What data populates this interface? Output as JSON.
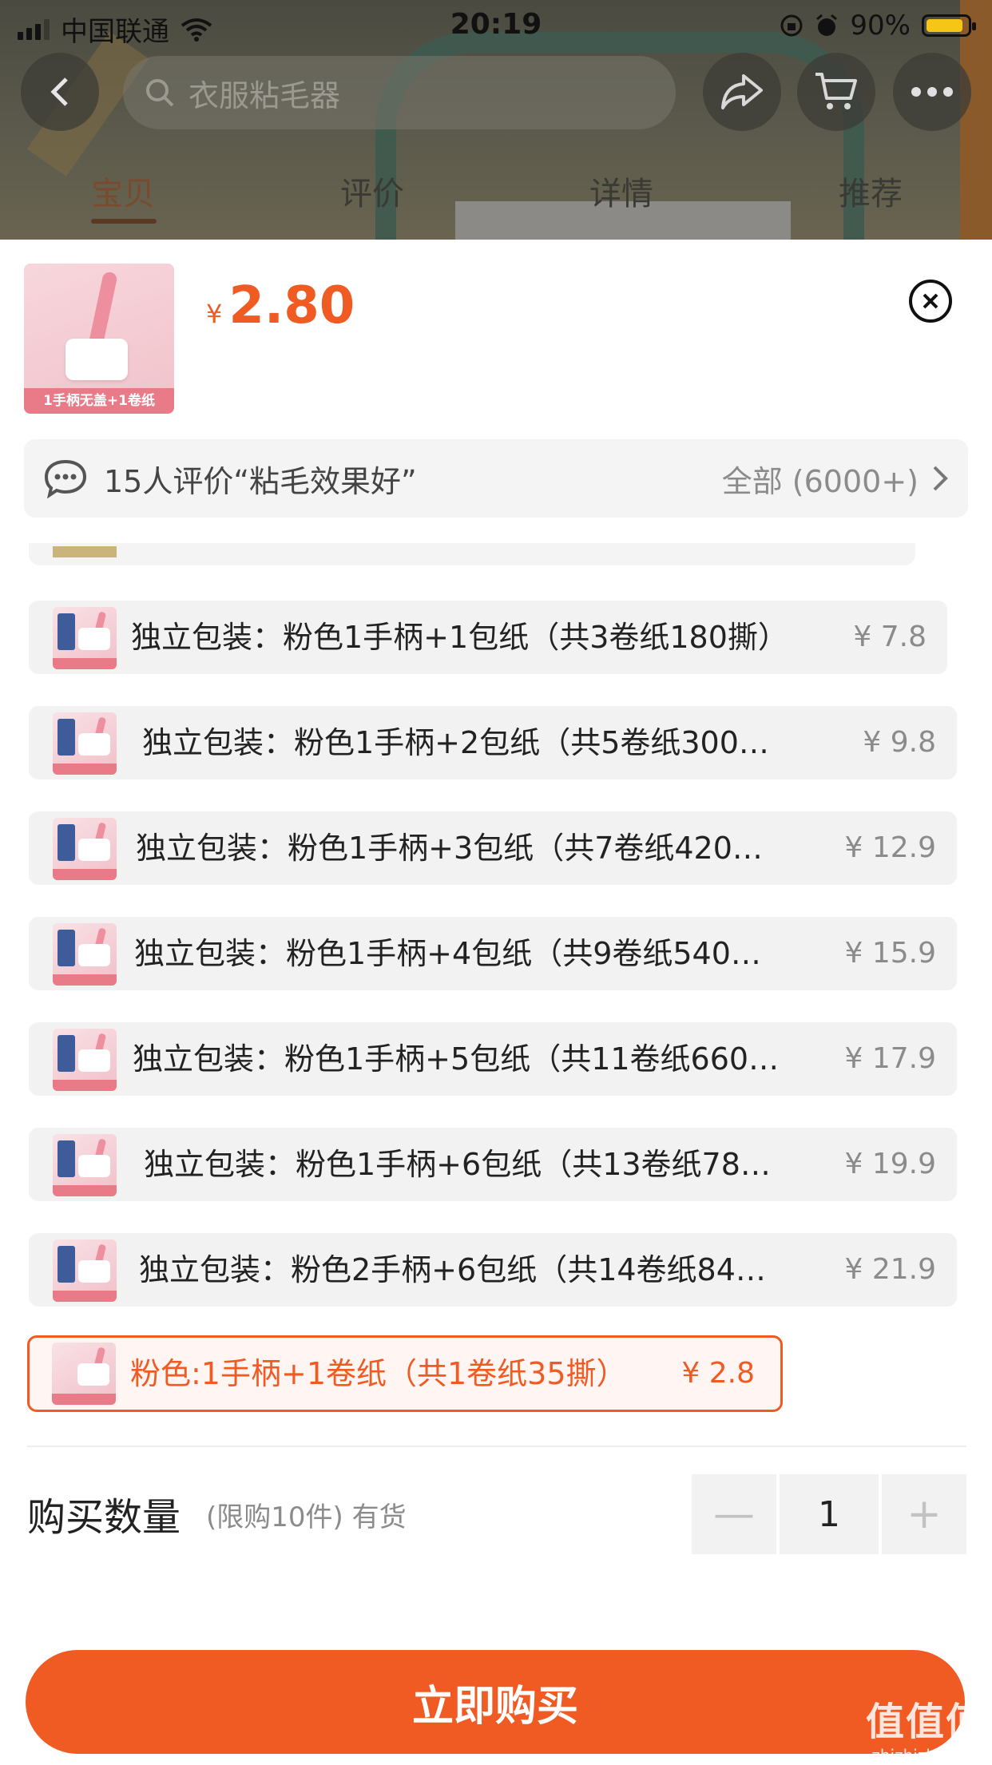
{
  "status_bar": {
    "carrier": "中国联通",
    "time": "20:19",
    "battery": "90%",
    "battery_level": 0.9
  },
  "top_nav": {
    "search_placeholder": "衣服粘毛器",
    "tabs": [
      {
        "label": "宝贝",
        "active": true
      },
      {
        "label": "评价",
        "active": false
      },
      {
        "label": "详情",
        "active": false
      },
      {
        "label": "推荐",
        "active": false
      }
    ]
  },
  "product": {
    "currency": "¥",
    "price": "2.80",
    "thumbnail_caption": "1手柄无盖+1卷纸"
  },
  "review_bar": {
    "text": "15人评价“粘毛效果好”",
    "all_label": "全部 (6000+)"
  },
  "options": [
    {
      "label": "独立包装：粉色1手柄+1包纸（共3卷纸180撕）",
      "price": "¥ 7.8",
      "selected": false
    },
    {
      "label": "独立包装：粉色1手柄+2包纸（共5卷纸300…",
      "price": "¥ 9.8",
      "selected": false
    },
    {
      "label": "独立包装：粉色1手柄+3包纸（共7卷纸420…",
      "price": "¥ 12.9",
      "selected": false
    },
    {
      "label": "独立包装：粉色1手柄+4包纸（共9卷纸540…",
      "price": "¥ 15.9",
      "selected": false
    },
    {
      "label": "独立包装：粉色1手柄+5包纸（共11卷纸660…",
      "price": "¥ 17.9",
      "selected": false
    },
    {
      "label": "独立包装：粉色1手柄+6包纸（共13卷纸78…",
      "price": "¥ 19.9",
      "selected": false
    },
    {
      "label": "独立包装：粉色2手柄+6包纸（共14卷纸84…",
      "price": "¥ 21.9",
      "selected": false
    },
    {
      "label": "粉色:1手柄+1卷纸（共1卷纸35撕）",
      "price": "¥ 2.8",
      "selected": true
    }
  ],
  "quantity": {
    "title": "购买数量",
    "note": "(限购10件) 有货",
    "value": "1",
    "minus": "—",
    "plus": "+"
  },
  "buy_button": "立即购买",
  "watermark": {
    "big": "值值值",
    "small": "zhizhizhi.com"
  },
  "colors": {
    "accent": "#ef5b23",
    "selected_bg": "#fff5f2",
    "option_bg": "#f2f2f2"
  }
}
